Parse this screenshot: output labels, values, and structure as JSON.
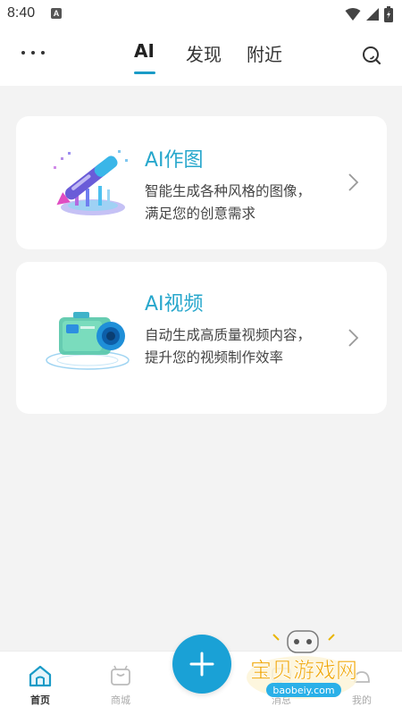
{
  "status_bar": {
    "time": "8:40",
    "notification_glyph": "A"
  },
  "top_nav": {
    "tabs": [
      {
        "label": "AI"
      },
      {
        "label": "发现"
      },
      {
        "label": "附近"
      }
    ],
    "accent_color": "#1a9bc7"
  },
  "cards": [
    {
      "title": "AI作图",
      "description": "智能生成各种风格的图像，满足您的创意需求",
      "icon": "paintbrush-illustration-icon"
    },
    {
      "title": "AI视频",
      "description": "自动生成高质量视频内容，提升您的视频制作效率",
      "icon": "camera-illustration-icon"
    }
  ],
  "bottom_nav": {
    "items": [
      {
        "label": "首页",
        "icon": "home-icon",
        "active": true
      },
      {
        "label": "商城",
        "icon": "shopping-bag-icon",
        "active": false
      },
      {
        "label": "消息",
        "icon": "message-icon",
        "active": false
      },
      {
        "label": "我的",
        "icon": "profile-icon",
        "active": false
      }
    ],
    "fab_icon": "plus-icon",
    "fab_color": "#1aa1d6"
  },
  "watermark": {
    "text": "宝贝游戏网",
    "url": "baobeiy.com"
  }
}
